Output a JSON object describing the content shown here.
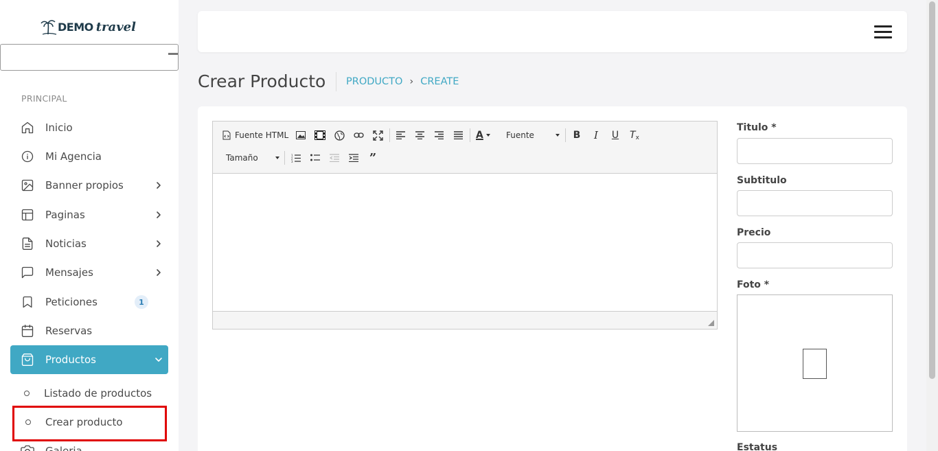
{
  "brand": {
    "demo": "DEMO",
    "travel": "travel"
  },
  "sidebar": {
    "section_label": "PRINCIPAL",
    "items": [
      {
        "label": "Inicio",
        "icon": "home-icon",
        "chevron": false
      },
      {
        "label": "Mi Agencia",
        "icon": "info-icon",
        "chevron": false
      },
      {
        "label": "Banner propios",
        "icon": "image-icon",
        "chevron": true
      },
      {
        "label": "Paginas",
        "icon": "layout-icon",
        "chevron": true
      },
      {
        "label": "Noticias",
        "icon": "file-text-icon",
        "chevron": true
      },
      {
        "label": "Mensajes",
        "icon": "message-square-icon",
        "chevron": true
      },
      {
        "label": "Peticiones",
        "icon": "bookmark-icon",
        "chevron": false,
        "badge": "1"
      },
      {
        "label": "Reservas",
        "icon": "calendar-icon",
        "chevron": false
      },
      {
        "label": "Productos",
        "icon": "shopping-bag-icon",
        "chevron": true,
        "active": true
      }
    ],
    "sub_items": [
      {
        "label": "Listado de productos"
      },
      {
        "label": "Crear producto",
        "highlighted": true
      }
    ],
    "partial_item": {
      "label": "Galeria",
      "icon": "camera-icon"
    }
  },
  "header": {
    "page_title": "Crear Producto",
    "breadcrumb": [
      "PRODUCTO",
      "CREATE"
    ]
  },
  "editor": {
    "source_label": "Fuente HTML",
    "font_label": "Fuente",
    "size_label": "Tamaño",
    "content": ""
  },
  "form": {
    "titulo_label": "Titulo *",
    "titulo_value": "",
    "subtitulo_label": "Subtitulo",
    "subtitulo_value": "",
    "precio_label": "Precio",
    "precio_value": "",
    "foto_label": "Foto *",
    "estatus_label": "Estatus"
  },
  "colors": {
    "accent": "#40a8c4",
    "highlight": "#e00000",
    "badge_bg": "#e3eef9"
  }
}
